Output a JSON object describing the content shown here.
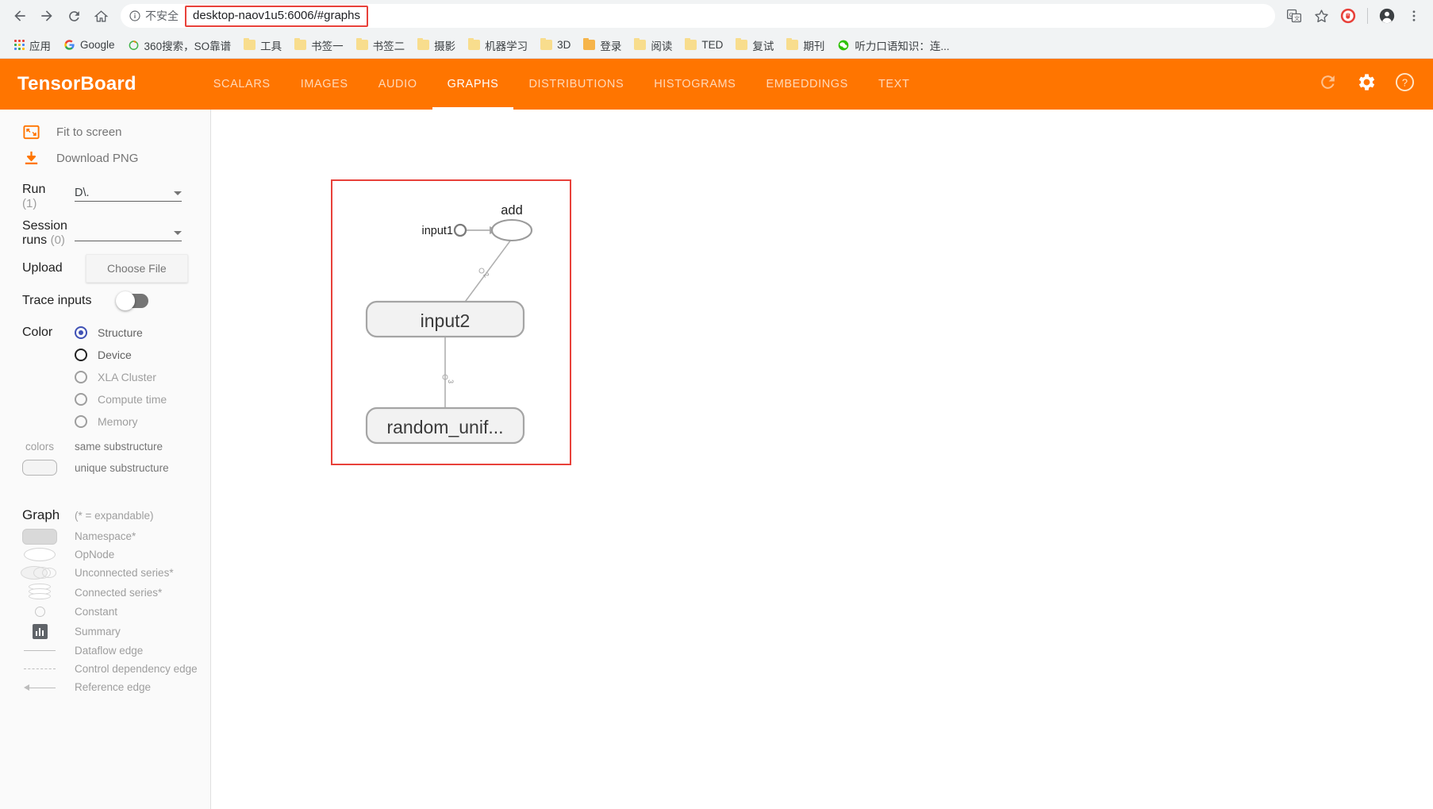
{
  "browser": {
    "nav": {
      "back": "back-arrow",
      "forward": "forward-arrow",
      "reload": "reload",
      "home": "home"
    },
    "omnibox": {
      "security_icon": "info-circle-icon",
      "security_text": "不安全",
      "url": "desktop-naov1u5:6006/#graphs",
      "highlight_color": "#e8413a"
    },
    "actions": [
      {
        "name": "translate-icon",
        "glyph": "translate"
      },
      {
        "name": "bookmark-star-icon",
        "glyph": "star"
      },
      {
        "name": "adblock-extension-icon",
        "glyph": "adblock"
      },
      {
        "name": "profile-avatar-icon",
        "glyph": "avatar"
      },
      {
        "name": "chrome-menu-icon",
        "glyph": "kebab"
      }
    ],
    "bookmarks": [
      {
        "label": "应用",
        "icon": "apps-grid-icon"
      },
      {
        "label": "Google",
        "icon": "google-icon"
      },
      {
        "label": "360搜索，SO靠谱",
        "icon": "so360-icon"
      },
      {
        "label": "工具",
        "icon": "folder-icon"
      },
      {
        "label": "书签一",
        "icon": "folder-icon"
      },
      {
        "label": "书签二",
        "icon": "folder-icon"
      },
      {
        "label": "摄影",
        "icon": "folder-icon"
      },
      {
        "label": "机器学习",
        "icon": "folder-icon"
      },
      {
        "label": "3D",
        "icon": "folder-icon"
      },
      {
        "label": "登录",
        "icon": "folder-open-icon"
      },
      {
        "label": "阅读",
        "icon": "folder-icon"
      },
      {
        "label": "TED",
        "icon": "folder-icon"
      },
      {
        "label": "复试",
        "icon": "folder-icon"
      },
      {
        "label": "期刊",
        "icon": "folder-icon"
      },
      {
        "label": "听力口语知识：连...",
        "icon": "wechat-icon"
      }
    ]
  },
  "tensorboard": {
    "brand": "TensorBoard",
    "accent_color": "#ff7500",
    "tabs": [
      {
        "label": "SCALARS",
        "active": false
      },
      {
        "label": "IMAGES",
        "active": false
      },
      {
        "label": "AUDIO",
        "active": false
      },
      {
        "label": "GRAPHS",
        "active": true
      },
      {
        "label": "DISTRIBUTIONS",
        "active": false
      },
      {
        "label": "HISTOGRAMS",
        "active": false
      },
      {
        "label": "EMBEDDINGS",
        "active": false
      },
      {
        "label": "TEXT",
        "active": false
      }
    ],
    "header_actions": [
      {
        "name": "refresh-icon",
        "glyph": "refresh"
      },
      {
        "name": "settings-gear-icon",
        "glyph": "gear"
      },
      {
        "name": "help-icon",
        "glyph": "question"
      }
    ]
  },
  "sidebar": {
    "fit_to_screen": "Fit to screen",
    "download_png": "Download PNG",
    "run": {
      "label": "Run",
      "count": "(1)",
      "value": "D\\."
    },
    "session_runs": {
      "label": "Session runs",
      "label_line1": "Session",
      "label_line2": "runs",
      "count": "(0)",
      "value": ""
    },
    "upload": {
      "label": "Upload",
      "button": "Choose File"
    },
    "trace_inputs": {
      "label": "Trace inputs",
      "on": false
    },
    "color": {
      "label": "Color",
      "options": [
        {
          "label": "Structure",
          "checked": true,
          "enabled": true
        },
        {
          "label": "Device",
          "checked": false,
          "enabled": true
        },
        {
          "label": "XLA Cluster",
          "checked": false,
          "enabled": false
        },
        {
          "label": "Compute time",
          "checked": false,
          "enabled": false
        },
        {
          "label": "Memory",
          "checked": false,
          "enabled": false
        }
      ]
    },
    "colors_legend": {
      "caption": "colors",
      "same_substructure": "same substructure",
      "unique_substructure": "unique substructure"
    },
    "graph_legend": {
      "title": "Graph",
      "note": "(* = expandable)",
      "items": [
        {
          "label": "Namespace*",
          "shape": "namespace"
        },
        {
          "label": "OpNode",
          "shape": "opnode"
        },
        {
          "label": "Unconnected series*",
          "shape": "unconnected-series"
        },
        {
          "label": "Connected series*",
          "shape": "connected-series"
        },
        {
          "label": "Constant",
          "shape": "constant"
        },
        {
          "label": "Summary",
          "shape": "summary"
        },
        {
          "label": "Dataflow edge",
          "shape": "dataflow-edge"
        },
        {
          "label": "Control dependency edge",
          "shape": "control-edge"
        },
        {
          "label": "Reference edge",
          "shape": "reference-edge"
        }
      ]
    }
  },
  "graph": {
    "highlight_color": "#e8413a",
    "nodes": [
      {
        "id": "input1",
        "label": "input1",
        "type": "constant"
      },
      {
        "id": "add",
        "label": "add",
        "type": "opnode"
      },
      {
        "id": "input2",
        "label": "input2",
        "type": "namespace"
      },
      {
        "id": "random_uniform",
        "label": "random_unif...",
        "type": "namespace"
      }
    ],
    "edges": [
      {
        "from": "input1",
        "to": "add",
        "label": ""
      },
      {
        "from": "input2",
        "to": "add",
        "label": "2"
      },
      {
        "from": "random_uniform",
        "to": "input2",
        "label": "3"
      }
    ]
  }
}
